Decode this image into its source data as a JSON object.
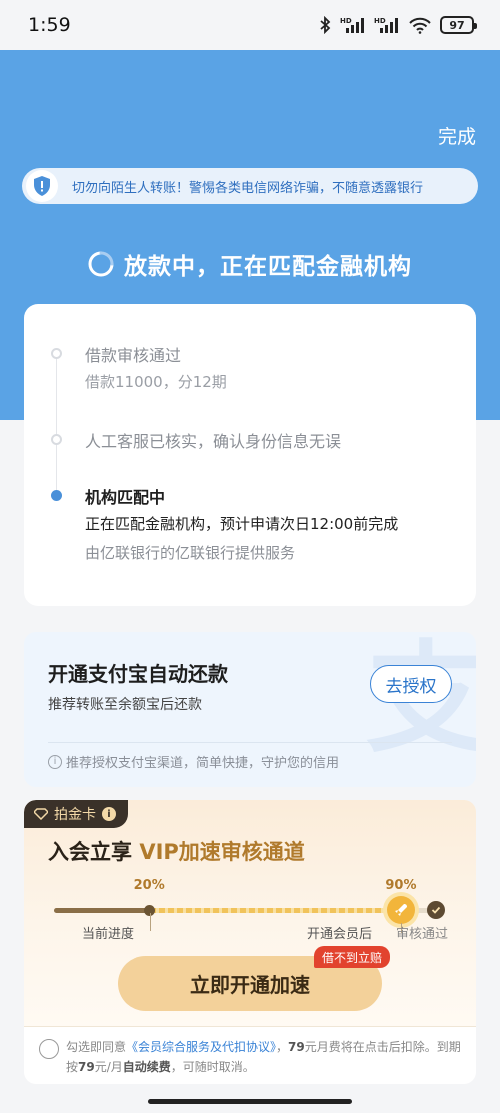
{
  "status_bar": {
    "time": "1:59",
    "battery": "97",
    "network_labels": [
      "HD",
      "HD"
    ]
  },
  "header": {
    "done_label": "完成"
  },
  "warning": {
    "text": "切勿向陌生人转账！警惕各类电信网络诈骗，不随意透露银行"
  },
  "status": {
    "title": "放款中，正在匹配金融机构"
  },
  "steps": [
    {
      "title": "借款审核通过",
      "sub": "借款11000，分12期",
      "state": "done"
    },
    {
      "title": "人工客服已核实，确认身份信息无误",
      "state": "done"
    },
    {
      "title": "机构匹配中",
      "sub": "正在匹配金融机构，预计申请次日12:00前完成",
      "sub2": "由亿联银行的亿联银行提供服务",
      "state": "active"
    }
  ],
  "alipay": {
    "title": "开通支付宝自动还款",
    "subtitle": "推荐转账至余额宝后还款",
    "button": "去授权",
    "note": "推荐授权支付宝渠道，简单快捷，守护您的信用",
    "watermark": "支"
  },
  "vip": {
    "tag": "拍金卡",
    "headline_prefix": "入会立享 ",
    "headline_gold": "VIP加速审核通道",
    "progress": {
      "current_pct_label": "20%",
      "member_pct_label": "90%",
      "current_fraction": 0.2,
      "member_fraction": 0.9,
      "label_current": "当前进度",
      "label_member": "开通会员后",
      "label_pass": "审核通过"
    },
    "button": "立即开通加速",
    "badge": "借不到立赔"
  },
  "agreement": {
    "prefix": "勾选即同意",
    "link": "《会员综合服务及代扣协议》",
    "mid1": "，",
    "price1": "79",
    "mid2": "元月费将在点击后扣除。到期按",
    "price2": "79",
    "mid3": "元/月",
    "renew": "自动续费",
    "suffix": "，可随时取消。"
  },
  "colors": {
    "primary_blue": "#5aa3e5",
    "gold": "#b07a2c",
    "badge_red": "#e2432e"
  }
}
